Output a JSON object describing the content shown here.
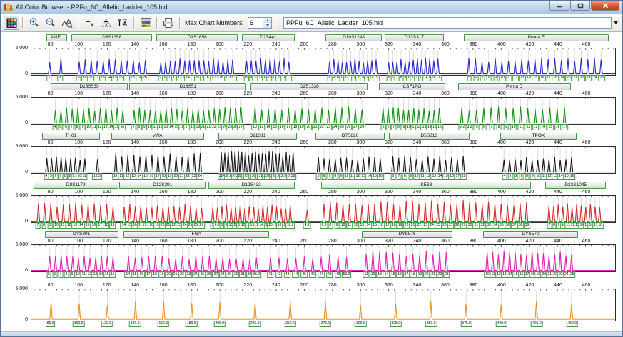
{
  "window": {
    "title": "All Color Browser - PPFu_6C_Allelic_Ladder_105.hid"
  },
  "toolbar": {
    "max_chart_label": "Max Chart Numbers:",
    "max_chart_value": "6",
    "filename": "PPFu_6C_Allelic_Ladder_105.hid",
    "icons": [
      "all-color",
      "zoom-in",
      "zoom-out",
      "zoom-chart",
      "remove-sizing",
      "average-sizing",
      "allele-labels",
      "color-table",
      "print"
    ]
  },
  "chart_data": {
    "type": "electropherogram",
    "axis": {
      "bp_min": 66,
      "bp_max": 481,
      "ticks": [
        80,
        100,
        120,
        140,
        160,
        180,
        200,
        220,
        240,
        260,
        280,
        300,
        320,
        340,
        360,
        380,
        400,
        420,
        440,
        460
      ],
      "y_top": "5,000",
      "y_bottom": "0"
    },
    "rows": [
      {
        "name": "blue",
        "color": "#2929cf",
        "markers": [
          {
            "label": "AMEL",
            "bp": [
              77,
              91
            ]
          },
          {
            "label": "D3S1358",
            "bp": [
              95,
              151
            ]
          },
          {
            "label": "D1S1656",
            "bp": [
              155,
              212
            ]
          },
          {
            "label": "D2S441",
            "bp": [
              216,
              252
            ]
          },
          {
            "label": "D10S1248",
            "bp": [
              275,
              314
            ]
          },
          {
            "label": "D13S317",
            "bp": [
              317,
              358
            ]
          },
          {
            "label": "Penta E",
            "bp": [
              373,
              475
            ]
          }
        ],
        "groups": [
          {
            "bp": [
              79,
              87
            ],
            "h": 0.6,
            "alleles": [
              "X",
              "Y"
            ]
          },
          {
            "bp": [
              100,
              147
            ],
            "h": 0.58,
            "alleles": [
              "9",
              "10",
              "11",
              "12",
              "13",
              "14",
              "15",
              "16",
              "17",
              "18",
              "19",
              "20"
            ]
          },
          {
            "bp": [
              158,
              209
            ],
            "h": 0.58,
            "alleles": [
              "9",
              "10",
              "11",
              "12",
              "13",
              "14",
              "14.3",
              "15",
              "15.3",
              "16",
              "16.3",
              "17",
              "17.3",
              "18.3",
              "19",
              "20.3"
            ]
          },
          {
            "bp": [
              219,
              249
            ],
            "h": 0.6,
            "alleles": [
              "8",
              "9",
              "10",
              "11",
              "12",
              "13",
              "14",
              "15",
              "16",
              "17"
            ]
          },
          {
            "bp": [
              278,
              311
            ],
            "h": 0.58,
            "alleles": [
              "8",
              "9",
              "10",
              "11",
              "12",
              "13",
              "14",
              "15",
              "16",
              "17",
              "18",
              "19"
            ]
          },
          {
            "bp": [
              320,
              355
            ],
            "h": 0.58,
            "alleles": [
              "5",
              "6",
              "7",
              "8",
              "9",
              "10",
              "11",
              "12",
              "13",
              "14",
              "15",
              "16",
              "17"
            ]
          },
          {
            "bp": [
              377,
              471
            ],
            "h": 0.6,
            "alleles": [
              "5",
              "6",
              "7",
              "8",
              "9",
              "10",
              "11",
              "12",
              "13",
              "14",
              "15",
              "16",
              "17",
              "18",
              "19",
              "20",
              "21",
              "22",
              "23",
              "24",
              "25"
            ]
          }
        ]
      },
      {
        "name": "green",
        "color": "#0f930f",
        "markers": [
          {
            "label": "D16S539",
            "bp": [
              80,
              134
            ]
          },
          {
            "label": "D18S51",
            "bp": [
              136,
              218
            ]
          },
          {
            "label": "D2S1338",
            "bp": [
              222,
              304
            ]
          },
          {
            "label": "CSF1PO",
            "bp": [
              313,
              359
            ]
          },
          {
            "label": "Penta D",
            "bp": [
              369,
              448
            ]
          }
        ],
        "groups": [
          {
            "bp": [
              83,
              131
            ],
            "h": 0.6,
            "alleles": [
              "4",
              "5",
              "6",
              "7",
              "8",
              "9",
              "10",
              "11",
              "12",
              "13",
              "14",
              "15",
              "16"
            ]
          },
          {
            "bp": [
              139,
              215
            ],
            "h": 0.6,
            "alleles": [
              "7",
              "8",
              "9",
              "10",
              "11",
              "12",
              "13",
              "14",
              "15",
              "16",
              "17",
              "18",
              "19",
              "20",
              "21",
              "22",
              "23",
              "24",
              "25",
              "26",
              "27"
            ]
          },
          {
            "bp": [
              225,
              301
            ],
            "h": 0.62,
            "alleles": [
              "10",
              "12",
              "14",
              "15",
              "16",
              "17",
              "18",
              "19",
              "20",
              "21",
              "22",
              "23",
              "24",
              "25",
              "26",
              "27",
              "28"
            ]
          },
          {
            "bp": [
              316,
              356
            ],
            "h": 0.6,
            "alleles": [
              "5",
              "6",
              "7",
              "8",
              "9",
              "10",
              "11",
              "12",
              "13",
              "14",
              "15",
              "16"
            ]
          },
          {
            "bp": [
              372,
              445
            ],
            "h": 0.62,
            "alleles": [
              "2.2",
              "3.2",
              "5",
              "6",
              "7",
              "8",
              "9",
              "10",
              "11",
              "12",
              "13",
              "14",
              "15",
              "16",
              "17"
            ]
          }
        ]
      },
      {
        "name": "black",
        "color": "#161616",
        "markers": [
          {
            "label": "TH01",
            "bp": [
              74,
              114
            ]
          },
          {
            "label": "vWA",
            "bp": [
              123,
              188
            ]
          },
          {
            "label": "D21S11",
            "bp": [
              199,
              254
            ]
          },
          {
            "label": "D7S820",
            "bp": [
              268,
              316
            ]
          },
          {
            "label": "D5S818",
            "bp": [
              320,
              376
            ]
          },
          {
            "label": "TPOX",
            "bp": [
              399,
              452
            ]
          }
        ],
        "groups": [
          {
            "bp": [
              77,
              104
            ],
            "h": 0.6,
            "alleles": [
              "4",
              "5",
              "6",
              "7",
              "8",
              "9",
              "9.3",
              "10",
              "11"
            ]
          },
          {
            "bp": [
              112,
              114
            ],
            "h": 0.55,
            "alleles": [
              "13.3"
            ]
          },
          {
            "bp": [
              126,
              186
            ],
            "h": 0.72,
            "alleles": [
              "10",
              "11",
              "12",
              "13",
              "14",
              "15",
              "16",
              "17",
              "18",
              "19",
              "20",
              "21",
              "22",
              "23",
              "24"
            ]
          },
          {
            "bp": [
              201,
              252
            ],
            "h": 0.8,
            "alleles": [
              "24",
              "24.2",
              "25",
              "26",
              "27",
              "28",
              "28.2",
              "29",
              "29.2",
              "30",
              "30.2",
              "31",
              "31.2",
              "32",
              "32.2",
              "33",
              "33.2",
              "34",
              "35",
              "36",
              "37",
              "38"
            ]
          },
          {
            "bp": [
              270,
              314
            ],
            "h": 0.6,
            "alleles": [
              "5",
              "6",
              "7",
              "8",
              "9",
              "10",
              "11",
              "12",
              "13",
              "14",
              "15",
              "16"
            ]
          },
          {
            "bp": [
              323,
              373
            ],
            "h": 0.62,
            "alleles": [
              "6",
              "7",
              "8",
              "9",
              "10",
              "11",
              "12",
              "13",
              "14",
              "15",
              "16",
              "17",
              "18"
            ]
          },
          {
            "bp": [
              402,
              450
            ],
            "h": 0.6,
            "alleles": [
              "4",
              "5",
              "6",
              "7",
              "8",
              "9",
              "10",
              "11",
              "12",
              "13",
              "14",
              "15",
              "16"
            ]
          }
        ]
      },
      {
        "name": "red",
        "color": "#d42a2a",
        "markers": [
          {
            "label": "D8S1179",
            "bp": [
              68,
              127
            ]
          },
          {
            "label": "D12S391",
            "bp": [
              129,
              189
            ]
          },
          {
            "label": "D19S433",
            "bp": [
              192,
              252
            ]
          },
          {
            "label": "SE33",
            "bp": [
              272,
              420
            ]
          },
          {
            "label": "D22S1045",
            "bp": [
              431,
              473
            ]
          }
        ],
        "groups": [
          {
            "bp": [
              71,
              124
            ],
            "h": 0.72,
            "alleles": [
              "7",
              "8",
              "9",
              "10",
              "11",
              "12",
              "13",
              "14",
              "15",
              "16",
              "17",
              "18",
              "19"
            ]
          },
          {
            "bp": [
              132,
              187
            ],
            "h": 0.68,
            "alleles": [
              "14",
              "15",
              "16",
              "17",
              "17.3",
              "18",
              "19",
              "20",
              "21",
              "22",
              "23",
              "24",
              "25",
              "26",
              "27"
            ]
          },
          {
            "bp": [
              195,
              250
            ],
            "h": 0.62,
            "alleles": [
              "5",
              "6.2",
              "8",
              "9",
              "10",
              "11",
              "12",
              "12.2",
              "13",
              "13.2",
              "14",
              "14.2",
              "15",
              "15.2",
              "16",
              "16.2",
              "17",
              "18.2"
            ]
          },
          {
            "bp": [
              261,
              263
            ],
            "h": 0.5,
            "alleles": [
              "4.2"
            ]
          },
          {
            "bp": [
              274,
              418
            ],
            "h": 0.8,
            "alleles": [
              "6.3",
              "8",
              "9",
              "10",
              "11",
              "12",
              "13",
              "14",
              "15",
              "16",
              "17",
              "18",
              "19",
              "20",
              "21",
              "22",
              "23",
              "24",
              "25",
              "26",
              "27",
              "28",
              "29",
              "30",
              "31",
              "32",
              "33",
              "34",
              "35",
              "36",
              "37",
              "38",
              "39"
            ]
          },
          {
            "bp": [
              434,
              470
            ],
            "h": 0.7,
            "alleles": [
              "7",
              "8",
              "9",
              "10",
              "11",
              "12",
              "13",
              "14",
              "15",
              "16",
              "17",
              "18"
            ]
          }
        ]
      },
      {
        "name": "magenta",
        "color": "#e121b1",
        "markers": [
          {
            "label": "DYS391",
            "bp": [
              76,
              127
            ]
          },
          {
            "label": "FGA",
            "bp": [
              132,
              234
            ]
          },
          {
            "label": "DYS576",
            "bp": [
              301,
              364
            ]
          },
          {
            "label": "DYS570",
            "bp": [
              387,
              453
            ]
          }
        ],
        "groups": [
          {
            "bp": [
              79,
              124
            ],
            "h": 0.6,
            "alleles": [
              "5",
              "6",
              "7",
              "8",
              "9",
              "10",
              "11",
              "12",
              "13",
              "14",
              "15",
              "16"
            ]
          },
          {
            "bp": [
              135,
              226
            ],
            "h": 0.56,
            "alleles": [
              "14",
              "15",
              "16",
              "17",
              "18",
              "19",
              "20",
              "21",
              "22",
              "23",
              "24",
              "25",
              "26",
              "27",
              "28",
              "29",
              "30",
              "31",
              "32",
              "33.2"
            ]
          },
          {
            "bp": [
              236,
              290
            ],
            "h": 0.6,
            "alleles": [
              "41",
              "42",
              "43",
              "44",
              "45",
              "46",
              "47",
              "48",
              "49",
              "50.2"
            ]
          },
          {
            "bp": [
              304,
              361
            ],
            "h": 0.75,
            "alleles": [
              "11",
              "12",
              "13",
              "14",
              "15",
              "16",
              "17",
              "18",
              "19",
              "20",
              "21",
              "22",
              "23"
            ]
          },
          {
            "bp": [
              390,
              450
            ],
            "h": 0.75,
            "alleles": [
              "10",
              "11",
              "12",
              "13",
              "14",
              "15",
              "16",
              "17",
              "18",
              "19",
              "20",
              "21",
              "22",
              "23",
              "24",
              "25"
            ]
          }
        ]
      },
      {
        "name": "orange",
        "color": "#ef9021",
        "markers": [],
        "groups": [
          {
            "at": [
              80,
              100,
              120,
              140,
              160,
              180,
              200,
              225,
              250,
              275,
              300,
              325,
              350,
              375,
              400,
              425,
              450
            ],
            "h": 0.6,
            "alleles": [
              "80.0",
              "100.0",
              "120.0",
              "140.0",
              "160.0",
              "180.0",
              "200.0",
              "225.0",
              "250.0",
              "275.0",
              "300.0",
              "325.0",
              "350.0",
              "375.0",
              "400.0",
              "425.0",
              "450.0"
            ]
          }
        ]
      }
    ]
  }
}
